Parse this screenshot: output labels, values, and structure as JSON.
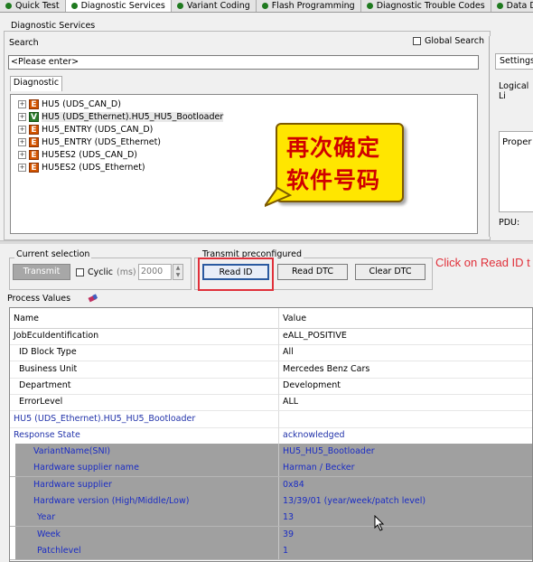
{
  "tabs": [
    {
      "label": "Quick Test",
      "active": false
    },
    {
      "label": "Diagnostic Services",
      "active": true
    },
    {
      "label": "Variant Coding",
      "active": false
    },
    {
      "label": "Flash Programming",
      "active": false
    },
    {
      "label": "Diagnostic Trouble Codes",
      "active": false
    },
    {
      "label": "Data Displa",
      "active": false
    }
  ],
  "diagnostic_services": {
    "title": "Diagnostic Services",
    "search_label": "Search",
    "search_value": "<Please enter>",
    "global_search_label": "Global Search",
    "diagnostic_tab": "Diagnostic"
  },
  "right_panel": {
    "settings_tab": "Settings",
    "logical_link_label": "Logical Li",
    "properties_label": "Proper",
    "pdu_label": "PDU:"
  },
  "tree": [
    {
      "badge": "E",
      "label": "HU5 (UDS_CAN_D)"
    },
    {
      "badge": "V",
      "label": "HU5 (UDS_Ethernet).HU5_HU5_Bootloader"
    },
    {
      "badge": "E",
      "label": "HU5_ENTRY (UDS_CAN_D)"
    },
    {
      "badge": "E",
      "label": "HU5_ENTRY (UDS_Ethernet)"
    },
    {
      "badge": "E",
      "label": "HU5ES2 (UDS_CAN_D)"
    },
    {
      "badge": "E",
      "label": "HU5ES2 (UDS_Ethernet)"
    }
  ],
  "callout": {
    "line1": "再次确定",
    "line2": "软件号码"
  },
  "current_selection": {
    "title": "Current selection",
    "transmit": "Transmit",
    "cyclic": "Cyclic",
    "ms": "(ms)",
    "interval": "2000"
  },
  "transmit_preconfigured": {
    "title": "Transmit preconfigured",
    "read_id": "Read ID",
    "read_dtc": "Read DTC",
    "clear_dtc": "Clear DTC"
  },
  "annotation": "Click on Read ID t",
  "process_values": {
    "title": "Process Values",
    "header": {
      "name": "Name",
      "value": "Value"
    },
    "rows": [
      {
        "name": "JobEcuIdentification",
        "value": "eALL_POSITIVE",
        "indent": 0,
        "style": "normal"
      },
      {
        "name": "ID Block Type",
        "value": "All",
        "indent": 1,
        "style": "normal"
      },
      {
        "name": "Business Unit",
        "value": "Mercedes Benz Cars",
        "indent": 1,
        "style": "normal"
      },
      {
        "name": "Department",
        "value": "Development",
        "indent": 1,
        "style": "normal"
      },
      {
        "name": "ErrorLevel",
        "value": "ALL",
        "indent": 1,
        "style": "normal"
      },
      {
        "name": "HU5 (UDS_Ethernet).HU5_HU5_Bootloader",
        "value": "",
        "indent": 0,
        "style": "blue"
      },
      {
        "name": "Response State",
        "value": "acknowledged",
        "indent": 0,
        "style": "blue"
      },
      {
        "name": "VariantName(SNI)",
        "value": "HU5_HU5_Bootloader",
        "indent": 2,
        "style": "sel"
      },
      {
        "name": "Hardware supplier name",
        "value": "Harman / Becker",
        "indent": 2,
        "style": "sel"
      },
      {
        "name": "Hardware supplier",
        "value": "0x84",
        "indent": 2,
        "style": "sel"
      },
      {
        "name": "Hardware version (High/Middle/Low)",
        "value": "13/39/01 (year/week/patch level)",
        "indent": 2,
        "style": "sel"
      },
      {
        "name": "Year",
        "value": "13",
        "indent": 3,
        "style": "sel"
      },
      {
        "name": "Week",
        "value": "39",
        "indent": 3,
        "style": "sel"
      },
      {
        "name": "Patchlevel",
        "value": "1",
        "indent": 3,
        "style": "sel"
      }
    ]
  },
  "colors": {
    "highlight_red": "#e0303a",
    "callout_yellow": "#ffe600",
    "callout_text": "#d00000"
  }
}
